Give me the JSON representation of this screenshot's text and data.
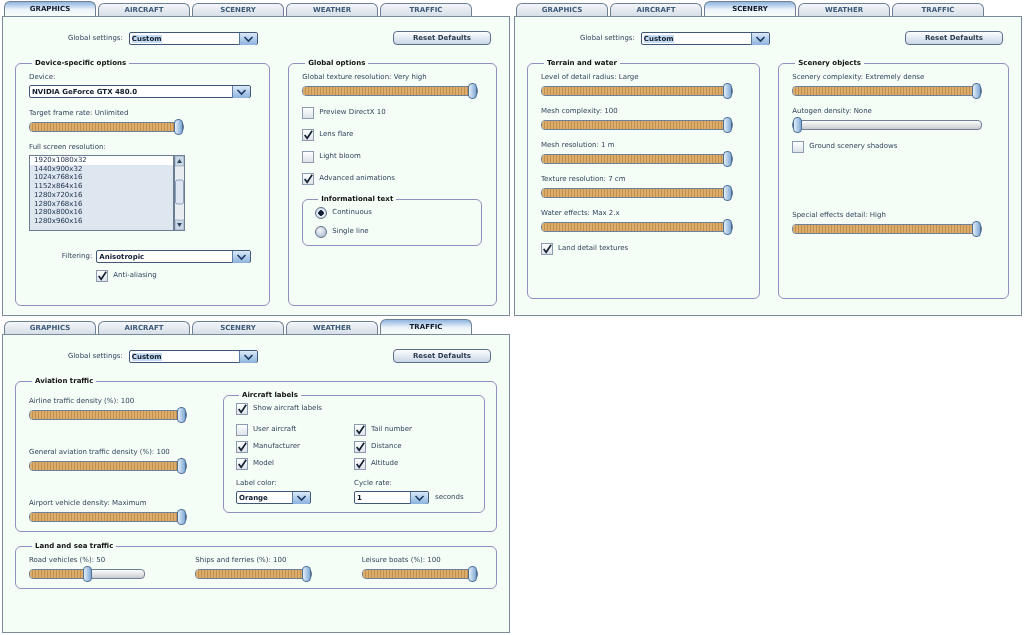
{
  "panels": [
    {
      "tabs": [
        {
          "label": "GRAPHICS",
          "selected": true
        },
        {
          "label": "AIRCRAFT",
          "selected": false
        },
        {
          "label": "SCENERY",
          "selected": false
        },
        {
          "label": "WEATHER",
          "selected": false
        },
        {
          "label": "TRAFFIC",
          "selected": false
        }
      ],
      "global_settings": {
        "label": "Global settings:",
        "value": "Custom"
      },
      "reset_button": "Reset Defaults",
      "groups": [
        {
          "title": "Device-specific options",
          "kind": "stack",
          "items": [
            {
              "kind": "dropdown",
              "label": "Device:",
              "value": "NVIDIA GeForce GTX 480.0"
            },
            {
              "kind": "slider",
              "label": "Target frame rate: Unlimited",
              "level": 1
            },
            {
              "kind": "listbox",
              "label": "Full screen resolution:",
              "options": [
                {
                  "text": "1920x1080x32",
                  "selected": true
                },
                {
                  "text": "1440x900x32",
                  "selected": false
                },
                {
                  "text": "1024x768x16",
                  "selected": false
                },
                {
                  "text": "1152x864x16",
                  "selected": false
                },
                {
                  "text": "1280x720x16",
                  "selected": false
                },
                {
                  "text": "1280x768x16",
                  "selected": false
                },
                {
                  "text": "1280x800x16",
                  "selected": false
                },
                {
                  "text": "1280x960x16",
                  "selected": false
                }
              ]
            },
            {
              "kind": "inline_dropdown",
              "label": "Filtering:",
              "value": "Anisotropic",
              "checkbox": {
                "label": "Anti-aliasing",
                "checked": true
              }
            }
          ]
        },
        {
          "title": "Global options",
          "kind": "stack",
          "items": [
            {
              "kind": "slider",
              "label": "Global texture resolution: Very high",
              "level": 1
            },
            {
              "kind": "checkbox",
              "label": "Preview DirectX 10",
              "checked": false
            },
            {
              "kind": "checkbox",
              "label": "Lens flare",
              "checked": true
            },
            {
              "kind": "checkbox",
              "label": "Light bloom",
              "checked": false
            },
            {
              "kind": "checkbox",
              "label": "Advanced animations",
              "checked": true
            },
            {
              "kind": "subgroup",
              "title": "Informational text",
              "items": [
                {
                  "kind": "radio",
                  "label": "Continuous",
                  "selected": true
                },
                {
                  "kind": "radio",
                  "label": "Single line",
                  "selected": false
                }
              ]
            }
          ]
        }
      ]
    },
    {
      "tabs": [
        {
          "label": "GRAPHICS",
          "selected": false
        },
        {
          "label": "AIRCRAFT",
          "selected": false
        },
        {
          "label": "SCENERY",
          "selected": true
        },
        {
          "label": "WEATHER",
          "selected": false
        },
        {
          "label": "TRAFFIC",
          "selected": false
        }
      ],
      "global_settings": {
        "label": "Global settings:",
        "value": "Custom"
      },
      "reset_button": "Reset Defaults",
      "groups": [
        {
          "title": "Terrain and water",
          "kind": "stack",
          "items": [
            {
              "kind": "slider",
              "label": "Level of detail radius: Large",
              "level": 1
            },
            {
              "kind": "slider",
              "label": "Mesh complexity: 100",
              "level": 1
            },
            {
              "kind": "slider",
              "label": "Mesh resolution: 1 m",
              "level": 1
            },
            {
              "kind": "slider",
              "label": "Texture resolution: 7 cm",
              "level": 1
            },
            {
              "kind": "slider",
              "label": "Water effects: Max 2.x",
              "level": 1
            },
            {
              "kind": "checkbox",
              "label": "Land detail textures",
              "checked": true
            }
          ]
        },
        {
          "title": "Scenery objects",
          "kind": "stack",
          "items": [
            {
              "kind": "slider",
              "label": "Scenery complexity: Extremely dense",
              "level": 1
            },
            {
              "kind": "slider",
              "label": "Autogen density: None",
              "level": 0
            },
            {
              "kind": "checkbox",
              "label": "Ground scenery shadows",
              "checked": false
            },
            {
              "kind": "slider",
              "label": "Special effects detail: High",
              "level": 1
            }
          ]
        }
      ]
    },
    {
      "tabs": [
        {
          "label": "GRAPHICS",
          "selected": false
        },
        {
          "label": "AIRCRAFT",
          "selected": false
        },
        {
          "label": "SCENERY",
          "selected": false
        },
        {
          "label": "WEATHER",
          "selected": false
        },
        {
          "label": "TRAFFIC",
          "selected": true
        }
      ],
      "global_settings": {
        "label": "Global settings:",
        "value": "Custom"
      },
      "reset_button": "Reset Defaults",
      "groups": [
        {
          "title": "Aviation traffic",
          "kind": "row",
          "items": [
            {
              "kind": "column",
              "items": [
                {
                  "kind": "slider",
                  "label": "Airline traffic density (%): 100",
                  "level": 1
                },
                {
                  "kind": "slider",
                  "label": "General aviation traffic density (%): 100",
                  "level": 1
                },
                {
                  "kind": "slider",
                  "label": "Airport vehicle density: Maximum",
                  "level": 1
                }
              ]
            },
            {
              "kind": "subgroup",
              "title": "Aircraft labels",
              "items": [
                {
                  "kind": "checkbox",
                  "label": "Show aircraft labels",
                  "checked": true
                },
                {
                  "kind": "grid",
                  "items": [
                    {
                      "kind": "checkbox",
                      "label": "User aircraft",
                      "checked": false
                    },
                    {
                      "kind": "checkbox",
                      "label": "Tail number",
                      "checked": true
                    },
                    {
                      "kind": "checkbox",
                      "label": "Manufacturer",
                      "checked": true
                    },
                    {
                      "kind": "checkbox",
                      "label": "Distance",
                      "checked": true
                    },
                    {
                      "kind": "checkbox",
                      "label": "Model",
                      "checked": true
                    },
                    {
                      "kind": "checkbox",
                      "label": "Altitude",
                      "checked": true
                    },
                    {
                      "kind": "dropdown",
                      "label": "Label color:",
                      "value": "Orange"
                    },
                    {
                      "kind": "dropdown",
                      "label": "Cycle rate:",
                      "value": "1",
                      "suffix": "seconds"
                    }
                  ]
                }
              ]
            }
          ]
        },
        {
          "title": "Land and sea traffic",
          "kind": "row",
          "items": [
            {
              "kind": "slider",
              "label": "Road vehicles (%): 50",
              "level": 0.5
            },
            {
              "kind": "slider",
              "label": "Ships and ferries (%): 100",
              "level": 1
            },
            {
              "kind": "slider",
              "label": "Leisure boats (%): 100",
              "level": 1
            }
          ]
        }
      ]
    }
  ]
}
